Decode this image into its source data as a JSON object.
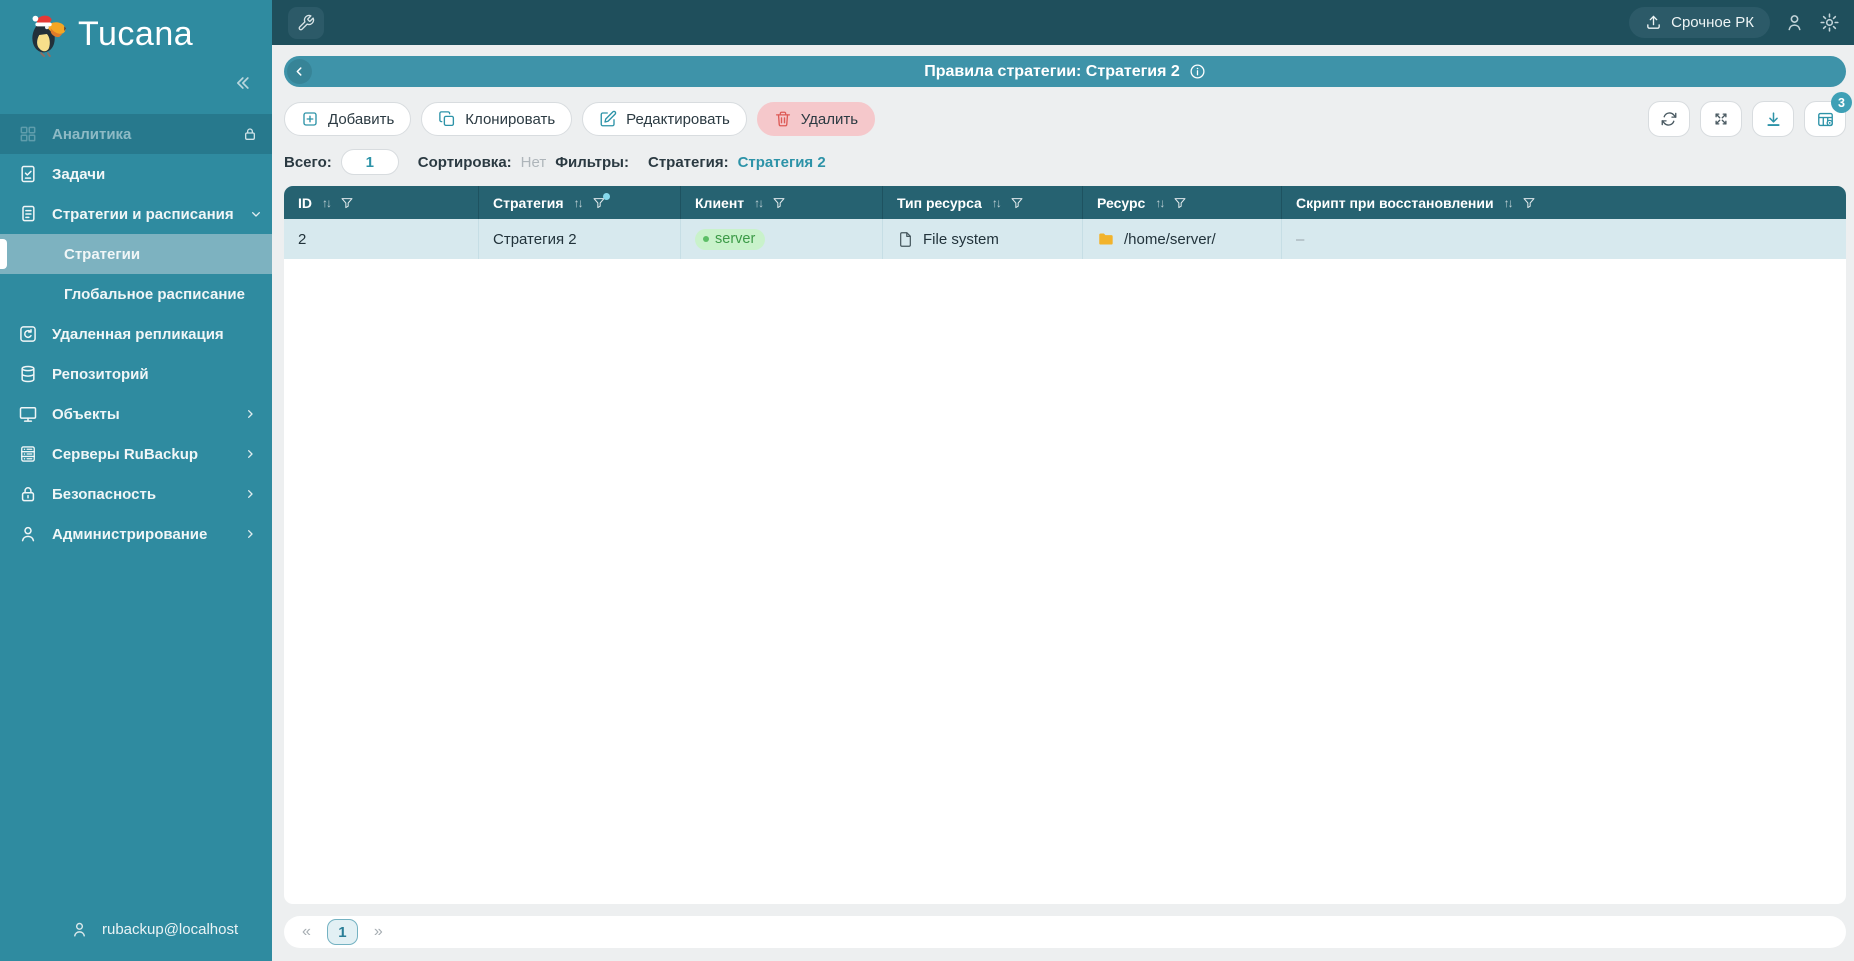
{
  "brand": {
    "name": "Tucana"
  },
  "topbar": {
    "urgent_button": "Срочное РК"
  },
  "page_header": {
    "title": "Правила стратегии: Стратегия 2"
  },
  "toolbar": {
    "add": "Добавить",
    "clone": "Клонировать",
    "edit": "Редактировать",
    "delete": "Удалить",
    "columns_badge": "3"
  },
  "summary": {
    "total_label": "Всего:",
    "total_value": "1",
    "sort_label": "Сортировка:",
    "sort_value": "Нет",
    "filters_label": "Фильтры:",
    "filter_field": "Стратегия:",
    "filter_value": "Стратегия 2"
  },
  "sidebar": {
    "items": [
      "Аналитика",
      "Задачи",
      "Стратегии и расписания",
      "Стратегии",
      "Глобальное расписание",
      "Удаленная репликация",
      "Репозиторий",
      "Объекты",
      "Серверы RuBackup",
      "Безопасность",
      "Администрирование"
    ],
    "user": "rubackup@localhost"
  },
  "table": {
    "sort_glyph": "↑↓",
    "columns": [
      "ID",
      "Стратегия",
      "Клиент",
      "Тип ресурса",
      "Ресурс",
      "Скрипт при восстановлении"
    ],
    "row": {
      "id": "2",
      "strategy": "Стратегия 2",
      "client": "server",
      "resource_type": "File system",
      "resource": "/home/server/",
      "restore_script": "–"
    }
  },
  "pagination": {
    "first": "«",
    "page": "1",
    "last": "»"
  },
  "colors": {
    "accent": "#2D93A8",
    "sidebar": "#2F8BA0",
    "topbar": "#1F4F5C",
    "page_header": "#3E93A9",
    "table_header": "#266271",
    "row": "#D7E9EE",
    "client_badge_bg": "#C9F2CB",
    "delete_bg": "#F5C8CB"
  }
}
